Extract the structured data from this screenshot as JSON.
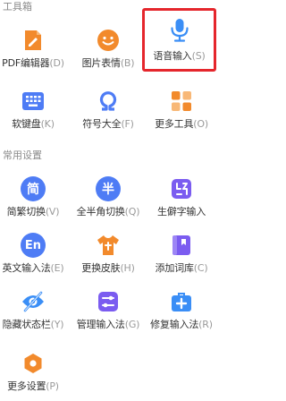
{
  "sections": {
    "toolbox": {
      "title": "工具箱"
    },
    "settings": {
      "title": "常用设置"
    }
  },
  "tools": [
    {
      "name": "PDF编辑器",
      "key": "(D)",
      "icon": "pdf-editor-icon",
      "color": "#f28a2c"
    },
    {
      "name": "图片表情",
      "key": "(B)",
      "icon": "emoji-icon",
      "color": "#f28a2c"
    },
    {
      "name": "语音输入",
      "key": "(S)",
      "icon": "microphone-icon",
      "color": "#3a8ef6",
      "selected": true
    },
    {
      "name": "软键盘",
      "key": "(K)",
      "icon": "keyboard-icon",
      "color": "#4e7cf5"
    },
    {
      "name": "符号大全",
      "key": "(F)",
      "icon": "omega-icon",
      "color": "#4e7cf5"
    },
    {
      "name": "更多工具",
      "key": "(O)",
      "icon": "more-tools-icon",
      "color": "#f28a2c"
    }
  ],
  "settings": [
    {
      "name": "简繁切换",
      "key": "(V)",
      "icon": "simplified-traditional-icon",
      "glyph": "简",
      "color": "#4e7cf5"
    },
    {
      "name": "全半角切换",
      "key": "(Q)",
      "icon": "full-half-width-icon",
      "glyph": "半",
      "color": "#4e7cf5"
    },
    {
      "name": "生僻字输入",
      "key": "",
      "icon": "rare-character-icon",
      "color": "#7b5cf0"
    },
    {
      "name": "英文输入法",
      "key": "(E)",
      "icon": "english-input-icon",
      "glyph": "En",
      "color": "#4e7cf5"
    },
    {
      "name": "更换皮肤",
      "key": "(H)",
      "icon": "skin-shirt-icon",
      "color": "#f28a2c"
    },
    {
      "name": "添加词库",
      "key": "(C)",
      "icon": "add-dictionary-icon",
      "color": "#7b5cf0"
    },
    {
      "name": "隐藏状态栏",
      "key": "(Y)",
      "icon": "hide-status-bar-icon",
      "color": "#3a8ef6"
    },
    {
      "name": "管理输入法",
      "key": "(G)",
      "icon": "manage-input-icon",
      "color": "#7b5cf0"
    },
    {
      "name": "修复输入法",
      "key": "(R)",
      "icon": "repair-kit-icon",
      "color": "#3a8ef6"
    },
    {
      "name": "更多设置",
      "key": "(P)",
      "icon": "more-settings-icon",
      "color": "#f28a2c"
    }
  ]
}
